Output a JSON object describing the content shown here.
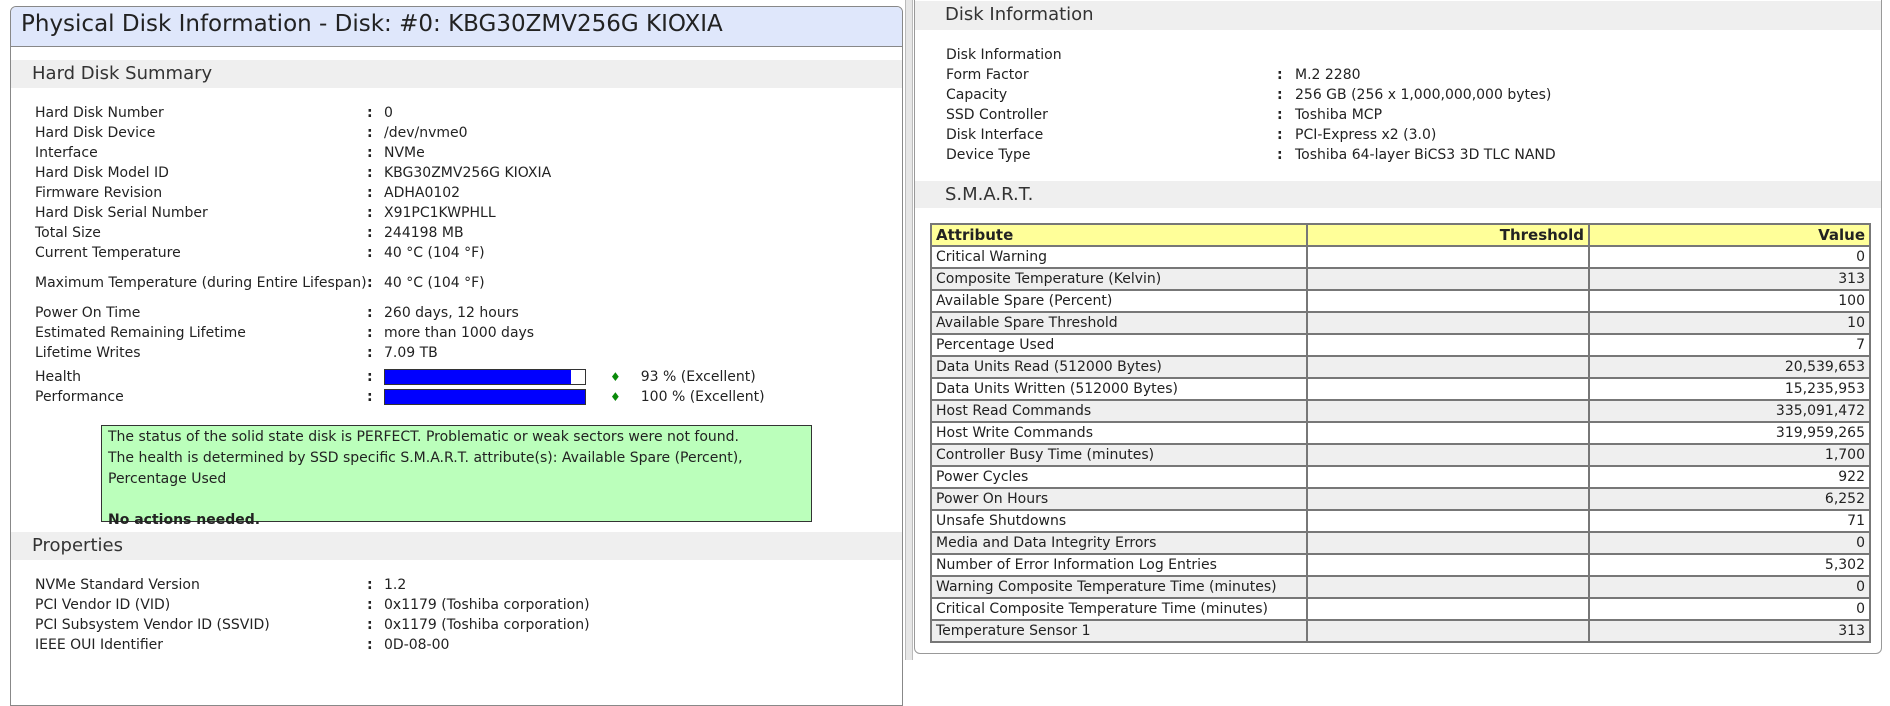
{
  "left": {
    "title": "Physical Disk Information - Disk: #0: KBG30ZMV256G KIOXIA",
    "summary_header": "Hard Disk Summary",
    "summary": [
      {
        "label": "Hard Disk Number",
        "value": "0"
      },
      {
        "label": "Hard Disk Device",
        "value": "/dev/nvme0"
      },
      {
        "label": "Interface",
        "value": "NVMe"
      },
      {
        "label": "Hard Disk Model ID",
        "value": "KBG30ZMV256G KIOXIA"
      },
      {
        "label": "Firmware Revision",
        "value": "ADHA0102"
      },
      {
        "label": "Hard Disk Serial Number",
        "value": "X91PC1KWPHLL"
      },
      {
        "label": "Total Size",
        "value": "244198 MB"
      },
      {
        "label": "Current Temperature",
        "value": "40 °C (104 °F)"
      },
      {
        "label": "Maximum Temperature (during Entire Lifespan)",
        "value": "40 °C (104 °F)"
      },
      {
        "label": "Power On Time",
        "value": "260 days, 12 hours"
      },
      {
        "label": "Estimated Remaining Lifetime",
        "value": "more than 1000 days"
      },
      {
        "label": "Lifetime Writes",
        "value": "7.09 TB"
      }
    ],
    "health": {
      "label": "Health",
      "percent": 93,
      "text": "93 % (Excellent)"
    },
    "performance": {
      "label": "Performance",
      "percent": 100,
      "text": "100 % (Excellent)"
    },
    "status": {
      "line1": "The status of the solid state disk is PERFECT. Problematic or weak sectors were not found.",
      "line2": "The health is determined by SSD specific S.M.A.R.T. attribute(s): Available Spare (Percent), Percentage Used",
      "line3": "No actions needed."
    },
    "properties_header": "Properties",
    "properties": [
      {
        "label": "NVMe Standard Version",
        "value": "1.2"
      },
      {
        "label": "PCI Vendor ID (VID)",
        "value": "0x1179 (Toshiba corporation)"
      },
      {
        "label": "PCI Subsystem Vendor ID (SSVID)",
        "value": "0x1179 (Toshiba corporation)"
      },
      {
        "label": "IEEE OUI Identifier",
        "value": "0D-08-00"
      }
    ]
  },
  "right": {
    "disk_info_header": "Disk Information",
    "disk_info_sub": "Disk Information",
    "disk_info": [
      {
        "label": "Form Factor",
        "value": "M.2 2280"
      },
      {
        "label": "Capacity",
        "value": "256 GB (256 x 1,000,000,000 bytes)"
      },
      {
        "label": "SSD Controller",
        "value": "Toshiba MCP"
      },
      {
        "label": "Disk Interface",
        "value": "PCI-Express x2 (3.0)"
      },
      {
        "label": "Device Type",
        "value": "Toshiba 64-layer BiCS3 3D TLC NAND"
      }
    ],
    "smart_header": "S.M.A.R.T.",
    "columns": [
      "Attribute",
      "Threshold",
      "Value"
    ],
    "rows": [
      [
        "Critical Warning",
        "",
        "0"
      ],
      [
        "Composite Temperature (Kelvin)",
        "",
        "313"
      ],
      [
        "Available Spare (Percent)",
        "",
        "100"
      ],
      [
        "Available Spare Threshold",
        "",
        "10"
      ],
      [
        "Percentage Used",
        "",
        "7"
      ],
      [
        "Data Units Read (512000 Bytes)",
        "",
        "20,539,653"
      ],
      [
        "Data Units Written (512000 Bytes)",
        "",
        "15,235,953"
      ],
      [
        "Host Read Commands",
        "",
        "335,091,472"
      ],
      [
        "Host Write Commands",
        "",
        "319,959,265"
      ],
      [
        "Controller Busy Time (minutes)",
        "",
        "1,700"
      ],
      [
        "Power Cycles",
        "",
        "922"
      ],
      [
        "Power On Hours",
        "",
        "6,252"
      ],
      [
        "Unsafe Shutdowns",
        "",
        "71"
      ],
      [
        "Media and Data Integrity Errors",
        "",
        "0"
      ],
      [
        "Number of Error Information Log Entries",
        "",
        "5,302"
      ],
      [
        "Warning Composite Temperature Time (minutes)",
        "",
        "0"
      ],
      [
        "Critical Composite Temperature Time (minutes)",
        "",
        "0"
      ],
      [
        "Temperature Sensor 1",
        "",
        "313"
      ]
    ]
  }
}
